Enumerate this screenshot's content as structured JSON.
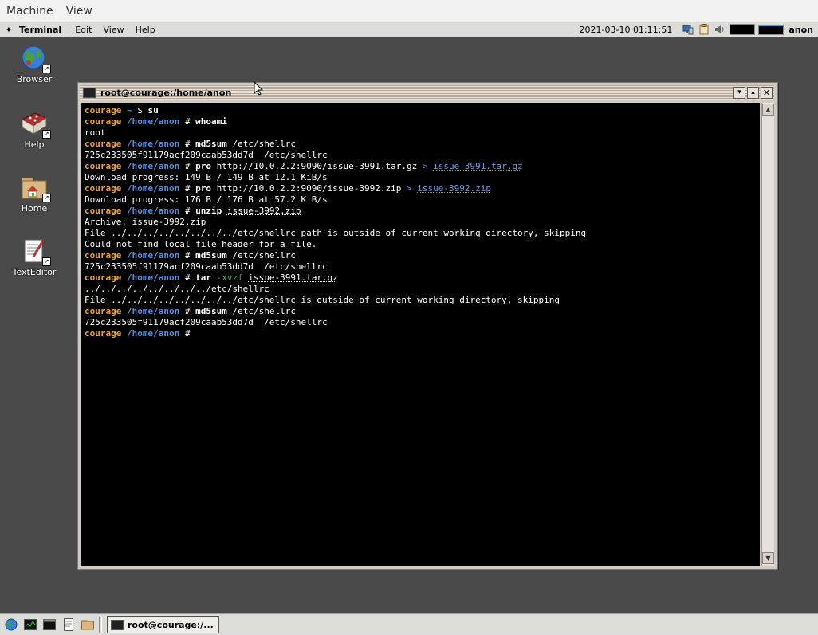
{
  "host_menubar": {
    "items": [
      "Machine",
      "View"
    ]
  },
  "top_panel": {
    "app_name": "Terminal",
    "menu": [
      "Edit",
      "View",
      "Help"
    ],
    "clock": "2021-03-10 01:11:51",
    "user": "anon"
  },
  "desktop_icons": [
    {
      "label": "Browser",
      "icon": "globe-icon"
    },
    {
      "label": "Help",
      "icon": "help-book-icon"
    },
    {
      "label": "Home",
      "icon": "home-folder-icon"
    },
    {
      "label": "TextEditor",
      "icon": "text-editor-icon"
    }
  ],
  "terminal": {
    "title": "root@courage:/home/anon",
    "lines": [
      [
        {
          "t": "courage",
          "c": "host"
        },
        {
          "t": " ~ ",
          "c": "path"
        },
        {
          "t": "$ ",
          "c": ""
        },
        {
          "t": "su",
          "c": "cmd"
        }
      ],
      [
        {
          "t": "courage",
          "c": "host"
        },
        {
          "t": " /home/anon ",
          "c": "path"
        },
        {
          "t": "# ",
          "c": ""
        },
        {
          "t": "whoami",
          "c": "cmd"
        }
      ],
      [
        {
          "t": "root",
          "c": ""
        }
      ],
      [
        {
          "t": "courage",
          "c": "host"
        },
        {
          "t": " /home/anon ",
          "c": "path"
        },
        {
          "t": "# ",
          "c": ""
        },
        {
          "t": "md5sum",
          "c": "cmd"
        },
        {
          "t": " /etc/shellrc",
          "c": "url"
        }
      ],
      [
        {
          "t": "725c233505f91179acf209caab53dd7d  /etc/shellrc",
          "c": ""
        }
      ],
      [
        {
          "t": "courage",
          "c": "host"
        },
        {
          "t": " /home/anon ",
          "c": "path"
        },
        {
          "t": "# ",
          "c": ""
        },
        {
          "t": "pro",
          "c": "cmd"
        },
        {
          "t": " http://10.0.2.2:9090/issue-3991.tar.gz ",
          "c": "url"
        },
        {
          "t": ">",
          "c": "gt"
        },
        {
          "t": " ",
          "c": ""
        },
        {
          "t": "issue-3991.tar.gz",
          "c": "file-link"
        }
      ],
      [
        {
          "t": "Download progress: 149 B / 149 B at 12.1 KiB/s",
          "c": ""
        }
      ],
      [
        {
          "t": "courage",
          "c": "host"
        },
        {
          "t": " /home/anon ",
          "c": "path"
        },
        {
          "t": "# ",
          "c": ""
        },
        {
          "t": "pro",
          "c": "cmd"
        },
        {
          "t": " http://10.0.2.2:9090/issue-3992.zip ",
          "c": "url"
        },
        {
          "t": ">",
          "c": "gt"
        },
        {
          "t": " ",
          "c": ""
        },
        {
          "t": "issue-3992.zip",
          "c": "file-link"
        }
      ],
      [
        {
          "t": "Download progress: 176 B / 176 B at 57.2 KiB/s",
          "c": ""
        }
      ],
      [
        {
          "t": "courage",
          "c": "host"
        },
        {
          "t": " /home/anon ",
          "c": "path"
        },
        {
          "t": "# ",
          "c": ""
        },
        {
          "t": "unzip",
          "c": "cmd"
        },
        {
          "t": " ",
          "c": ""
        },
        {
          "t": "issue-3992.zip",
          "c": "file"
        }
      ],
      [
        {
          "t": "Archive: issue-3992.zip",
          "c": ""
        }
      ],
      [
        {
          "t": "File ../../../../../../../../etc/shellrc path is outside of current working directory, skipping",
          "c": ""
        }
      ],
      [
        {
          "t": "Could not find local file header for a file.",
          "c": ""
        }
      ],
      [
        {
          "t": "courage",
          "c": "host"
        },
        {
          "t": " /home/anon ",
          "c": "path"
        },
        {
          "t": "# ",
          "c": ""
        },
        {
          "t": "md5sum",
          "c": "cmd"
        },
        {
          "t": " /etc/shellrc",
          "c": "url"
        }
      ],
      [
        {
          "t": "725c233505f91179acf209caab53dd7d  /etc/shellrc",
          "c": ""
        }
      ],
      [
        {
          "t": "courage",
          "c": "host"
        },
        {
          "t": " /home/anon ",
          "c": "path"
        },
        {
          "t": "# ",
          "c": ""
        },
        {
          "t": "tar",
          "c": "cmd"
        },
        {
          "t": " ",
          "c": ""
        },
        {
          "t": "-xvzf",
          "c": "flag"
        },
        {
          "t": " ",
          "c": ""
        },
        {
          "t": "issue-3991.tar.gz",
          "c": "file"
        }
      ],
      [
        {
          "t": "../../../../../../../../etc/shellrc",
          "c": ""
        }
      ],
      [
        {
          "t": "File ../../../../../../../../etc/shellrc is outside of current working directory, skipping",
          "c": ""
        }
      ],
      [
        {
          "t": "courage",
          "c": "host"
        },
        {
          "t": " /home/anon ",
          "c": "path"
        },
        {
          "t": "# ",
          "c": ""
        },
        {
          "t": "md5sum",
          "c": "cmd"
        },
        {
          "t": " /etc/shellrc",
          "c": "url"
        }
      ],
      [
        {
          "t": "725c233505f91179acf209caab53dd7d  /etc/shellrc",
          "c": ""
        }
      ],
      [
        {
          "t": "courage",
          "c": "host"
        },
        {
          "t": " /home/anon ",
          "c": "path"
        },
        {
          "t": "# ",
          "c": ""
        }
      ]
    ]
  },
  "taskbar": {
    "launchers": [
      "browser-launcher-icon",
      "system-monitor-icon",
      "terminal-launcher-icon",
      "text-editor-launcher-icon",
      "file-manager-icon"
    ],
    "task_label": "root@courage:/..."
  },
  "colors": {
    "desktop": "#4a4a4a",
    "terminal_bg": "#000000",
    "prompt_host": "#e8a23a",
    "prompt_path": "#5b8fd9"
  }
}
